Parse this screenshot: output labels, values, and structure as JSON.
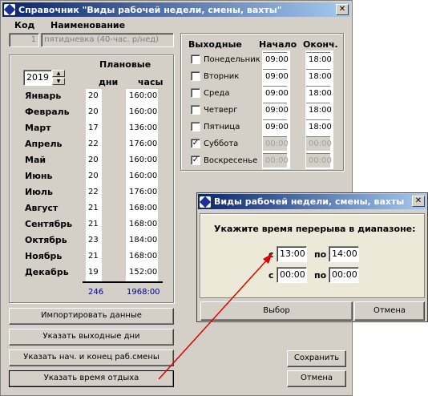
{
  "main_window": {
    "title": "Справочник \"Виды рабочей недели, смены, вахты\"",
    "close": "✕"
  },
  "header": {
    "code_label": "Код",
    "name_label": "Наименование",
    "code_value": "1",
    "name_value": "пятидневка (40-час. р/нед)"
  },
  "planned": {
    "header": "Плановые",
    "days_header": "дни",
    "hours_header": "часы",
    "year": "2019",
    "months": [
      {
        "name": "Январь",
        "days": "20",
        "hours": "160:00"
      },
      {
        "name": "Февраль",
        "days": "20",
        "hours": "160:00"
      },
      {
        "name": "Март",
        "days": "17",
        "hours": "136:00"
      },
      {
        "name": "Апрель",
        "days": "22",
        "hours": "176:00"
      },
      {
        "name": "Май",
        "days": "20",
        "hours": "160:00"
      },
      {
        "name": "Июнь",
        "days": "20",
        "hours": "160:00"
      },
      {
        "name": "Июль",
        "days": "22",
        "hours": "176:00"
      },
      {
        "name": "Август",
        "days": "21",
        "hours": "168:00"
      },
      {
        "name": "Сентябрь",
        "days": "21",
        "hours": "168:00"
      },
      {
        "name": "Октябрь",
        "days": "23",
        "hours": "184:00"
      },
      {
        "name": "Ноябрь",
        "days": "21",
        "hours": "168:00"
      },
      {
        "name": "Декабрь",
        "days": "19",
        "hours": "152:00"
      }
    ],
    "total_days": "246",
    "total_hours": "1968:00"
  },
  "weekdays": {
    "header_off": "Выходные",
    "header_start": "Начало",
    "header_end": "Оконч.",
    "days": [
      {
        "name": "Понедельник",
        "checked": false,
        "start": "09:00",
        "end": "18:00",
        "disabled": false
      },
      {
        "name": "Вторник",
        "checked": false,
        "start": "09:00",
        "end": "18:00",
        "disabled": false
      },
      {
        "name": "Среда",
        "checked": false,
        "start": "09:00",
        "end": "18:00",
        "disabled": false
      },
      {
        "name": "Четверг",
        "checked": false,
        "start": "09:00",
        "end": "18:00",
        "disabled": false
      },
      {
        "name": "Пятница",
        "checked": false,
        "start": "09:00",
        "end": "18:00",
        "disabled": false
      },
      {
        "name": "Суббота",
        "checked": true,
        "start": "00:00",
        "end": "00:00",
        "disabled": true
      },
      {
        "name": "Воскресенье",
        "checked": true,
        "start": "00:00",
        "end": "00:00",
        "disabled": true
      }
    ]
  },
  "buttons": {
    "import": "Импортировать данные",
    "set_days_off": "Указать выходные дни",
    "set_shift": "Указать нач. и конец раб.смены",
    "set_rest": "Указать время отдыха",
    "save": "Сохранить",
    "cancel": "Отмена"
  },
  "dialog": {
    "title": "Виды рабочей недели, смены, вахты",
    "close": "✕",
    "prompt": "Укажите время перерыва в диапазоне:",
    "from_label": "с",
    "to_label": "по",
    "from1": "13:00",
    "to1": "14:00",
    "from2": "00:00",
    "to2": "00:00",
    "ok": "Выбор",
    "cancel": "Отмена"
  },
  "colors": {
    "accent": "#0a246a",
    "arrow": "#e00000",
    "totals": "#000080"
  }
}
